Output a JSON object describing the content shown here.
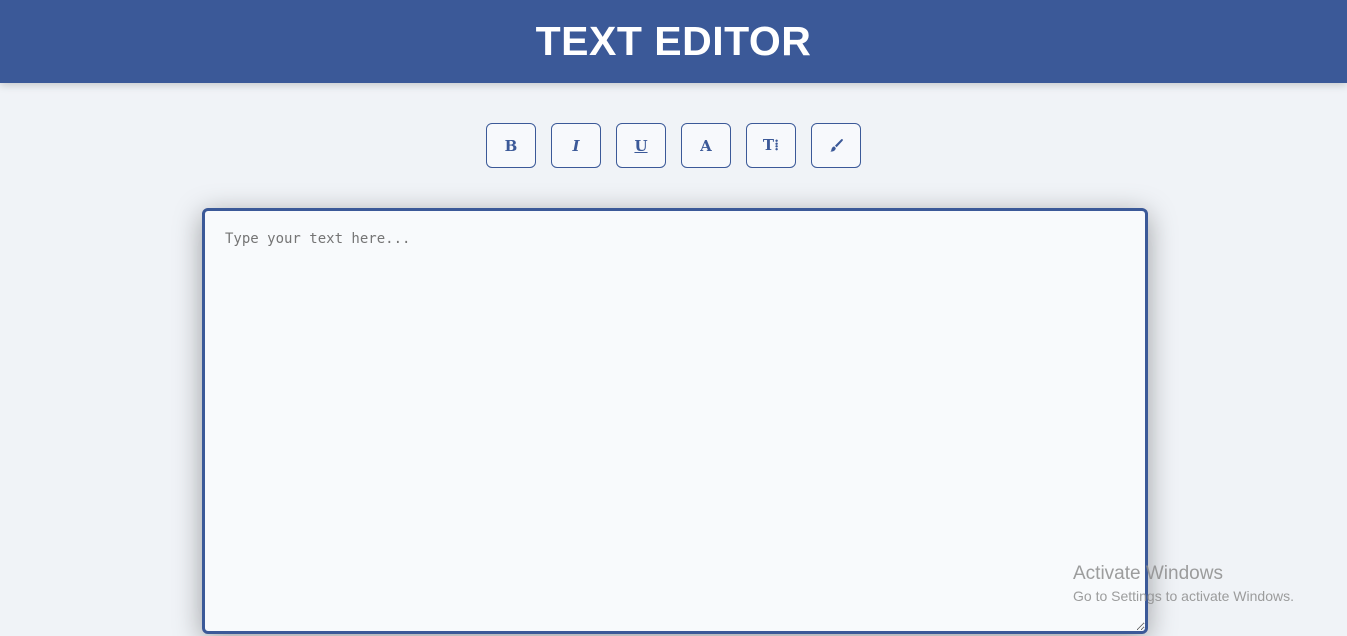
{
  "header": {
    "title": "TEXT EDITOR"
  },
  "toolbar": {
    "buttons": [
      {
        "label": "B",
        "icon": "bold-icon"
      },
      {
        "label": "I",
        "icon": "italic-icon"
      },
      {
        "label": "U",
        "icon": "underline-icon"
      },
      {
        "label": "A",
        "icon": "font-color-icon"
      },
      {
        "label": "T⁞",
        "icon": "font-size-icon"
      },
      {
        "label": "",
        "icon": "paint-brush-icon"
      }
    ]
  },
  "editor": {
    "placeholder": "Type your text here...",
    "value": ""
  },
  "watermark": {
    "title": "Activate Windows",
    "subtitle": "Go to Settings to activate Windows."
  },
  "colors": {
    "accent": "#3b5998",
    "background": "#f0f3f7",
    "editor_background": "#f8fafc"
  }
}
